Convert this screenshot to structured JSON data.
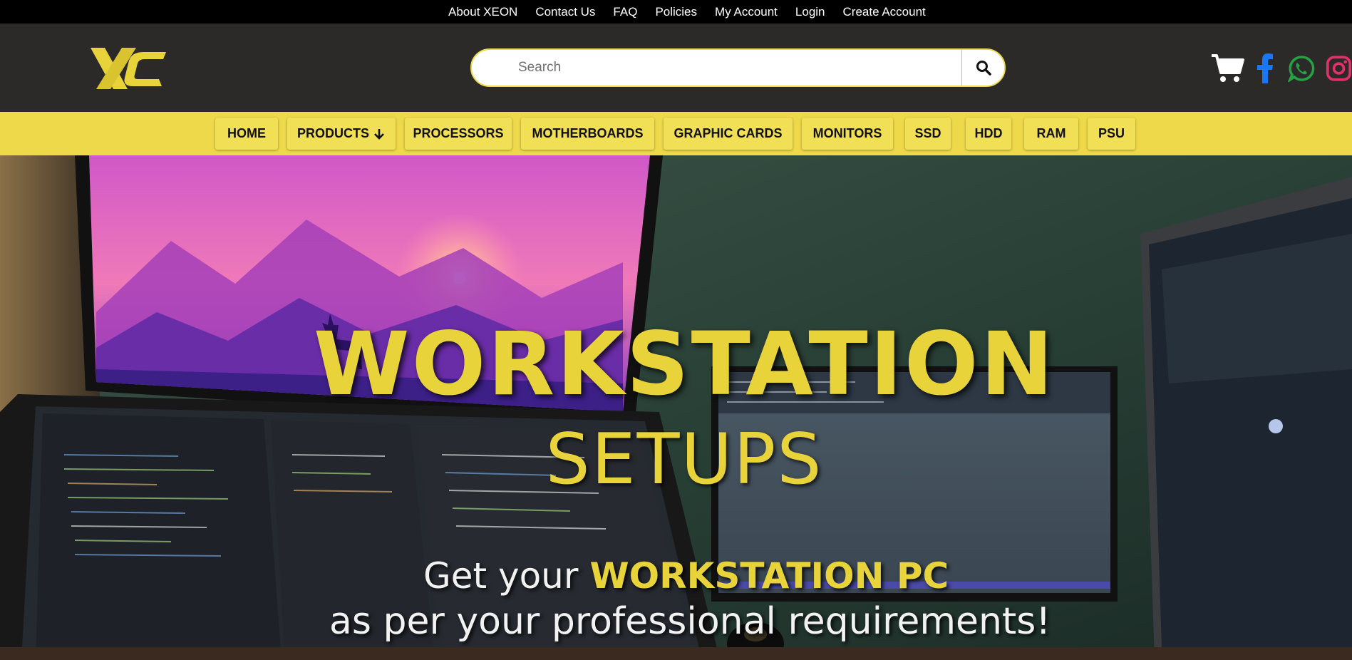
{
  "top_links": [
    "About XEON",
    "Contact Us",
    "FAQ",
    "Policies",
    "My Account",
    "Login",
    "Create Account"
  ],
  "header": {
    "logo_text": "XC",
    "search_placeholder": "Search",
    "search_icon": "magnifier-icon",
    "icons": [
      "cart-icon",
      "facebook-icon",
      "whatsapp-icon",
      "instagram-icon"
    ]
  },
  "nav": [
    "HOME",
    "PRODUCTS",
    "PROCESSORS",
    "MOTHERBOARDS",
    "GRAPHIC CARDS",
    "MONITORS",
    "SSD",
    "HDD",
    "RAM",
    "PSU"
  ],
  "nav_products_icon": "arrow-down-icon",
  "hero": {
    "title": "WORKSTATION",
    "subtitle": "SETUPS",
    "line1_plain": "Get your",
    "line1_accent": "WORKSTATION PC",
    "line2": "as per your professional requirements!"
  },
  "colors": {
    "brand_yellow": "#eed94a",
    "header_bg": "#2b2a28",
    "topbar_bg": "#000000",
    "facebook": "#1877f2",
    "whatsapp": "#25a244",
    "instagram": "#e1306c"
  }
}
